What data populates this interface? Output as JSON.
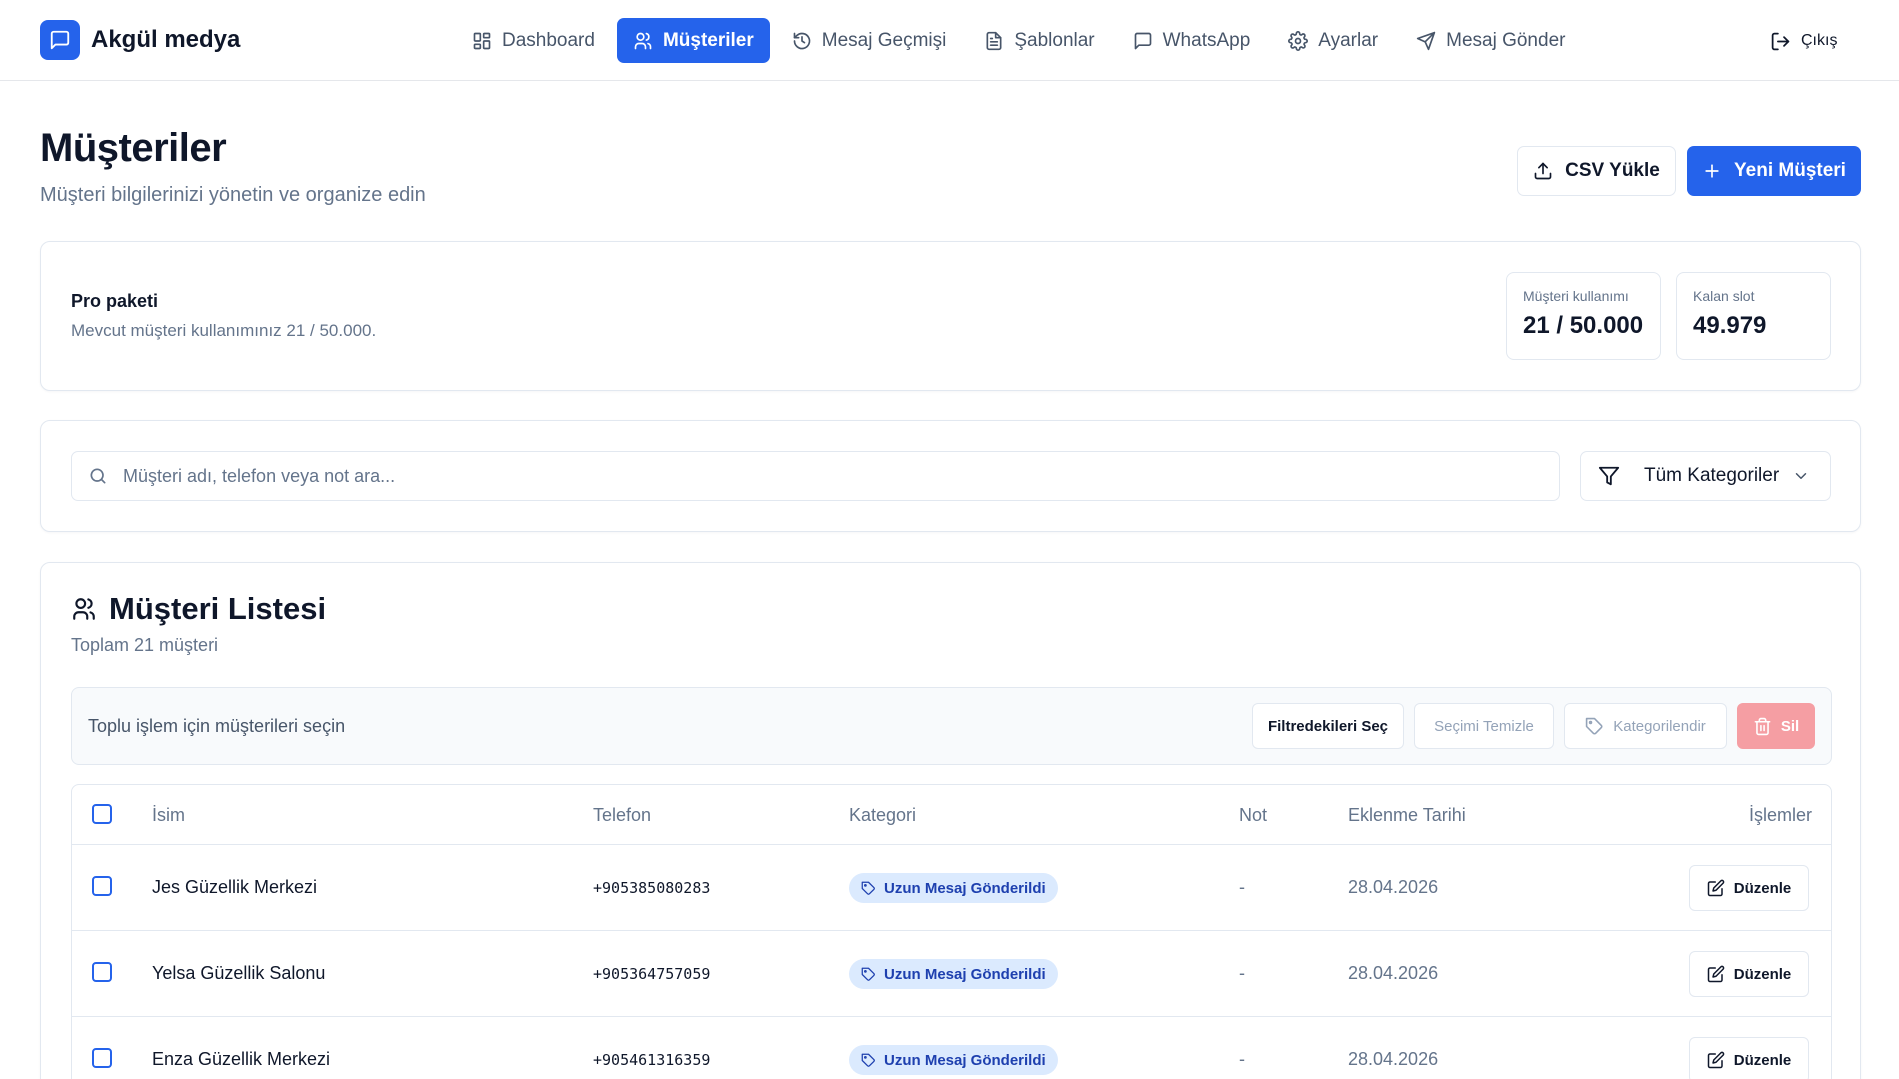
{
  "brand": {
    "name": "Akgül medya"
  },
  "nav": {
    "items": [
      {
        "label": "Dashboard",
        "icon": "layout-grid-icon",
        "active": false
      },
      {
        "label": "Müşteriler",
        "icon": "users-icon",
        "active": true
      },
      {
        "label": "Mesaj Geçmişi",
        "icon": "history-icon",
        "active": false
      },
      {
        "label": "Şablonlar",
        "icon": "file-text-icon",
        "active": false
      },
      {
        "label": "WhatsApp",
        "icon": "message-square-icon",
        "active": false
      },
      {
        "label": "Ayarlar",
        "icon": "gear-icon",
        "active": false
      },
      {
        "label": "Mesaj Gönder",
        "icon": "send-icon",
        "active": false
      }
    ],
    "logout_label": "Çıkış"
  },
  "header": {
    "title": "Müşteriler",
    "subtitle": "Müşteri bilgilerinizi yönetin ve organize edin",
    "csv_button": "CSV Yükle",
    "new_button": "Yeni Müşteri"
  },
  "plan": {
    "title": "Pro paketi",
    "description": "Mevcut müşteri kullanımınız 21 / 50.000.",
    "usage_label": "Müşteri kullanımı",
    "usage_value": "21 / 50.000",
    "remaining_label": "Kalan slot",
    "remaining_value": "49.979"
  },
  "search": {
    "placeholder": "Müşteri adı, telefon veya not ara...",
    "value": "",
    "category_selected": "Tüm Kategoriler"
  },
  "list": {
    "title": "Müşteri Listesi",
    "count_text": "Toplam 21 müşteri",
    "bulk_text": "Toplu işlem için müşterileri seçin",
    "bulk_buttons": {
      "select_filtered": "Filtredekileri Seç",
      "clear_selection": "Seçimi Temizle",
      "categorize": "Kategorilendir",
      "delete": "Sil"
    },
    "columns": {
      "name": "İsim",
      "phone": "Telefon",
      "category": "Kategori",
      "note": "Not",
      "date": "Eklenme Tarihi",
      "actions": "İşlemler"
    },
    "rows": [
      {
        "name": "Jes Güzellik Merkezi",
        "phone": "+905385080283",
        "category": "Uzun Mesaj Gönderildi",
        "note": "-",
        "date": "28.04.2026",
        "action": "Düzenle"
      },
      {
        "name": "Yelsa Güzellik Salonu",
        "phone": "+905364757059",
        "category": "Uzun Mesaj Gönderildi",
        "note": "-",
        "date": "28.04.2026",
        "action": "Düzenle"
      },
      {
        "name": "Enza Güzellik Merkezi",
        "phone": "+905461316359",
        "category": "Uzun Mesaj Gönderildi",
        "note": "-",
        "date": "28.04.2026",
        "action": "Düzenle"
      }
    ]
  },
  "colors": {
    "accent": "#2563eb",
    "badge_bg": "#dbeafe",
    "badge_text": "#1e40af",
    "danger_disabled": "#f59ea3"
  }
}
